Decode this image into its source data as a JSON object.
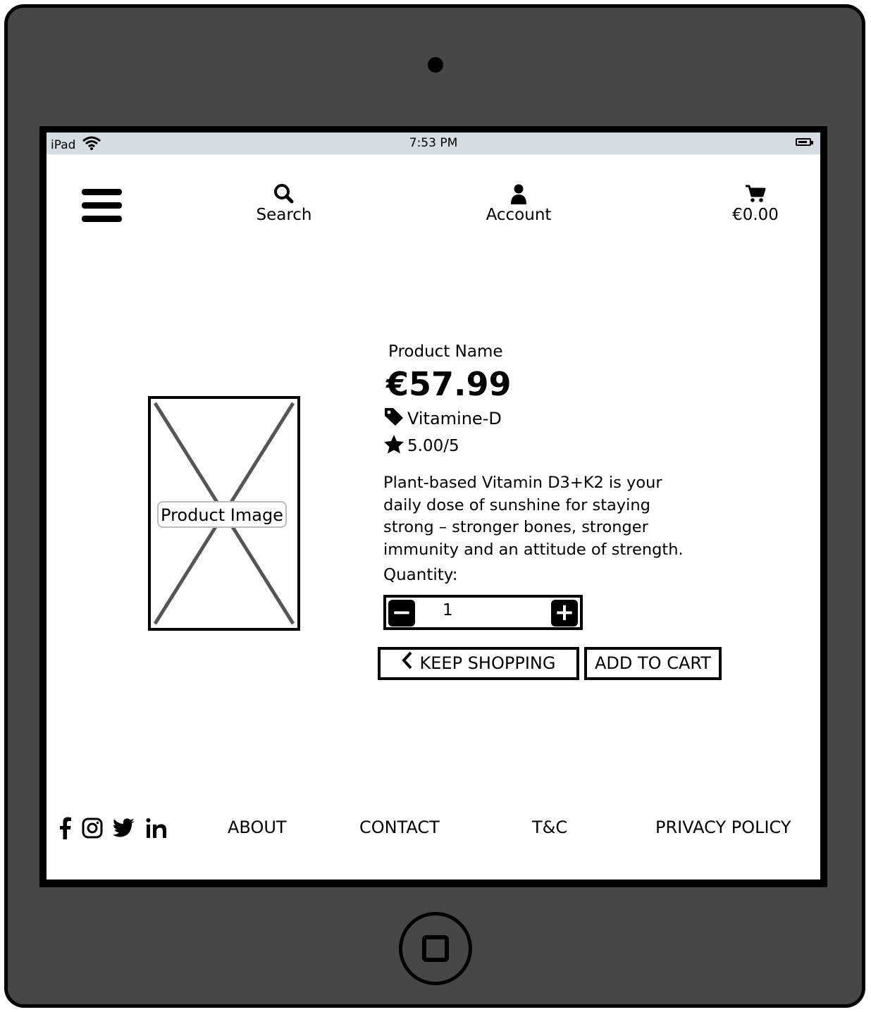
{
  "statusbar": {
    "device": "iPad",
    "time": "7:53 PM"
  },
  "nav": {
    "search_label": "Search",
    "account_label": "Account",
    "cart_total": "€0.00"
  },
  "product": {
    "image_placeholder": "Product Image",
    "name": "Product Name",
    "price": "€57.99",
    "tag": "Vitamine-D",
    "rating": "5.00/5",
    "description": "Plant-based Vitamin D3+K2 is your daily dose of sunshine for staying strong – stronger bones, stronger immunity and an attitude of strength.",
    "quantity_label": "Quantity:",
    "quantity_value": "1",
    "keep_shopping_label": "KEEP SHOPPING",
    "add_to_cart_label": "ADD TO CART"
  },
  "footer": {
    "social": [
      "facebook-icon",
      "instagram-icon",
      "twitter-icon",
      "linkedin-icon"
    ],
    "links": [
      "ABOUT",
      "CONTACT",
      "T&C",
      "PRIVACY POLICY"
    ]
  },
  "colors": {
    "device": "#474747",
    "statusbar": "#d6dde1",
    "screen": "#ffffff"
  }
}
